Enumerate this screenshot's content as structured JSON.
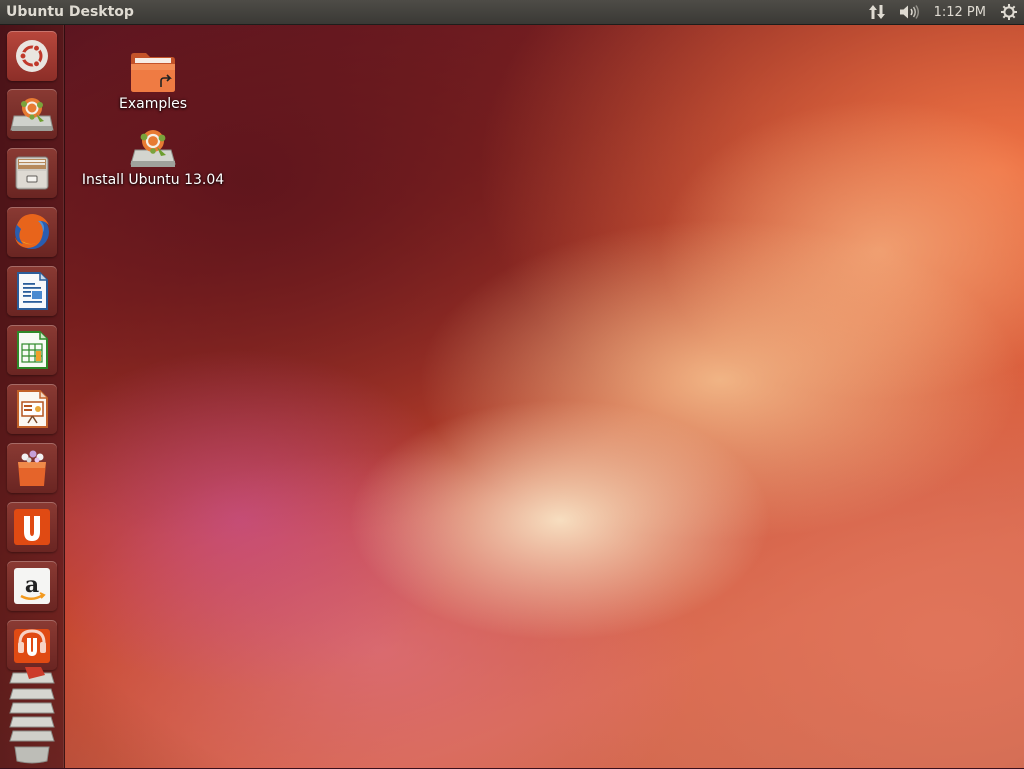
{
  "top_panel": {
    "title": "Ubuntu Desktop",
    "clock": "1:12 PM"
  },
  "indicators": [
    "network-indicator-icon",
    "sound-indicator-icon",
    "session-gear-icon"
  ],
  "launcher": {
    "items": [
      {
        "name": "dash-home",
        "icon": "ubuntu-logo-icon"
      },
      {
        "name": "install-ubuntu",
        "icon": "install-ubuntu-icon"
      },
      {
        "name": "files",
        "icon": "file-cabinet-icon"
      },
      {
        "name": "firefox",
        "icon": "firefox-icon"
      },
      {
        "name": "libreoffice-writer",
        "icon": "writer-document-icon"
      },
      {
        "name": "libreoffice-calc",
        "icon": "calc-spreadsheet-icon"
      },
      {
        "name": "libreoffice-impress",
        "icon": "impress-presentation-icon"
      },
      {
        "name": "software-center",
        "icon": "shopping-bag-icon"
      },
      {
        "name": "ubuntu-one",
        "icon": "ubuntu-one-icon"
      },
      {
        "name": "amazon",
        "icon": "amazon-icon"
      },
      {
        "name": "ubuntu-one-music",
        "icon": "ubuntu-one-music-icon"
      },
      {
        "name": "workspace-stack",
        "icon": "stacked-drives-icon"
      }
    ]
  },
  "desktop": {
    "icons": [
      {
        "label": "Examples",
        "icon": "folder-link-icon"
      },
      {
        "label": "Install Ubuntu 13.04",
        "icon": "install-ubuntu-icon"
      }
    ]
  },
  "colors": {
    "panel": "#3c3b37",
    "panel_text": "#dfdbd2",
    "launcher_tile": "#7a2e2a",
    "ubuntu_orange": "#dd4814"
  }
}
